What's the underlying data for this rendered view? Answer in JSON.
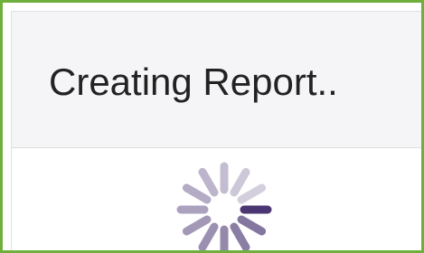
{
  "dialog": {
    "title": "Creating Report.."
  },
  "spinner": {
    "icon": "loading-spinner-icon",
    "color": "#4a3672",
    "segments": 12
  },
  "colors": {
    "frame_border": "#6fb03d",
    "header_background": "#f5f5f7",
    "title_text": "#222222",
    "spinner_accent": "#4a3672"
  }
}
